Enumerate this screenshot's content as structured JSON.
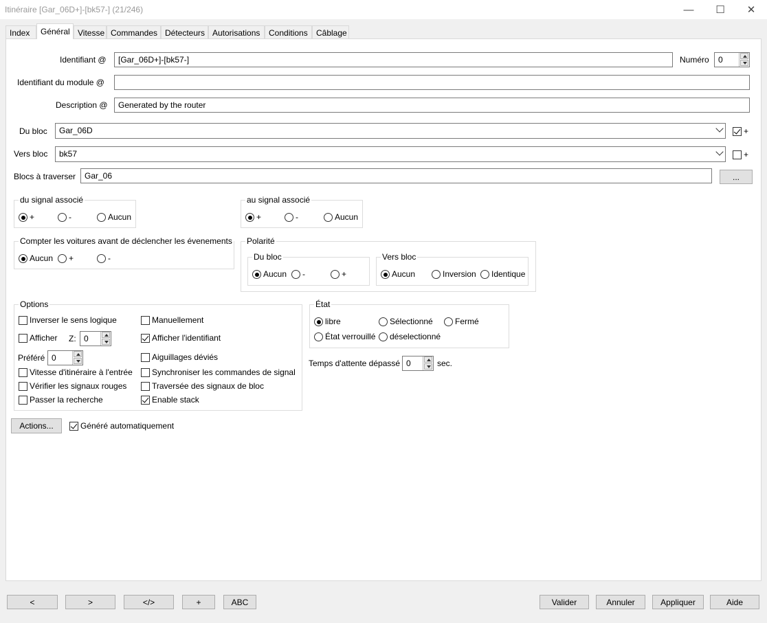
{
  "window": {
    "title": "Itinéraire [Gar_06D+]-[bk57-] (21/246)"
  },
  "tabs": [
    "Index",
    "Général",
    "Vitesse",
    "Commandes",
    "Détecteurs",
    "Autorisations",
    "Conditions",
    "Câblage"
  ],
  "active_tab": "Général",
  "general": {
    "id_label": "Identifiant @",
    "id_value": "[Gar_06D+]-[bk57-]",
    "number_label": "Numéro",
    "number_value": "0",
    "module_id_label": "Identifiant du module @",
    "module_id_value": "",
    "description_label": "Description @",
    "description_value": "Generated by the router",
    "from_block_label": "Du bloc",
    "from_block_value": "Gar_06D",
    "from_block_plus": "+",
    "to_block_label": "Vers bloc",
    "to_block_value": "bk57",
    "to_block_plus": "+",
    "cross_blocks_label": "Blocs à traverser",
    "cross_blocks_value": "Gar_06",
    "cross_blocks_button": "..."
  },
  "from_signal": {
    "title": "du signal associé",
    "options": [
      "+",
      "-",
      "Aucun"
    ],
    "selected": "+"
  },
  "to_signal": {
    "title": "au signal associé",
    "options": [
      "+",
      "-",
      "Aucun"
    ],
    "selected": "+"
  },
  "count_cars": {
    "title": "Compter les voitures avant de déclencher les évenements",
    "options": [
      "Aucun",
      "+",
      "-"
    ],
    "selected": "Aucun"
  },
  "polarity": {
    "title": "Polarité",
    "from_block": {
      "title": "Du bloc",
      "options": [
        "Aucun",
        "-",
        "+"
      ],
      "selected": "Aucun"
    },
    "to_block": {
      "title": "Vers bloc",
      "options": [
        "Aucun",
        "Inversion",
        "Identique"
      ],
      "selected": "Aucun"
    }
  },
  "options": {
    "title": "Options",
    "reverse_logic": "Inverser le sens logique",
    "manual": "Manuellement",
    "show": "Afficher",
    "z_label": "Z:",
    "z_value": "0",
    "show_id": "Afficher l'identifiant",
    "preferred_label": "Préféré",
    "preferred_value": "0",
    "diverted_switches": "Aiguillages déviés",
    "entry_speed": "Vitesse d'itinéraire à l'entrée",
    "sync_signal_cmds": "Synchroniser les commandes de signal",
    "check_red_signals": "Vérifier les signaux rouges",
    "cross_block_signals": "Traversée des signaux de bloc",
    "skip_search": "Passer la recherche",
    "enable_stack": "Enable stack"
  },
  "state": {
    "title": "État",
    "free": "libre",
    "selected": "Sélectionné",
    "closed": "Fermé",
    "locked": "État verrouillé",
    "deselected": "déselectionné",
    "current": "libre"
  },
  "timeout": {
    "label": "Temps d'attente dépassé",
    "value": "0",
    "unit": "sec."
  },
  "actions_button": "Actions...",
  "auto_generated": "Généré automatiquement",
  "footer": {
    "prev": "<",
    "next": ">",
    "xml": "</>",
    "add": "+",
    "abc": "ABC",
    "ok": "Valider",
    "cancel": "Annuler",
    "apply": "Appliquer",
    "help": "Aide"
  }
}
